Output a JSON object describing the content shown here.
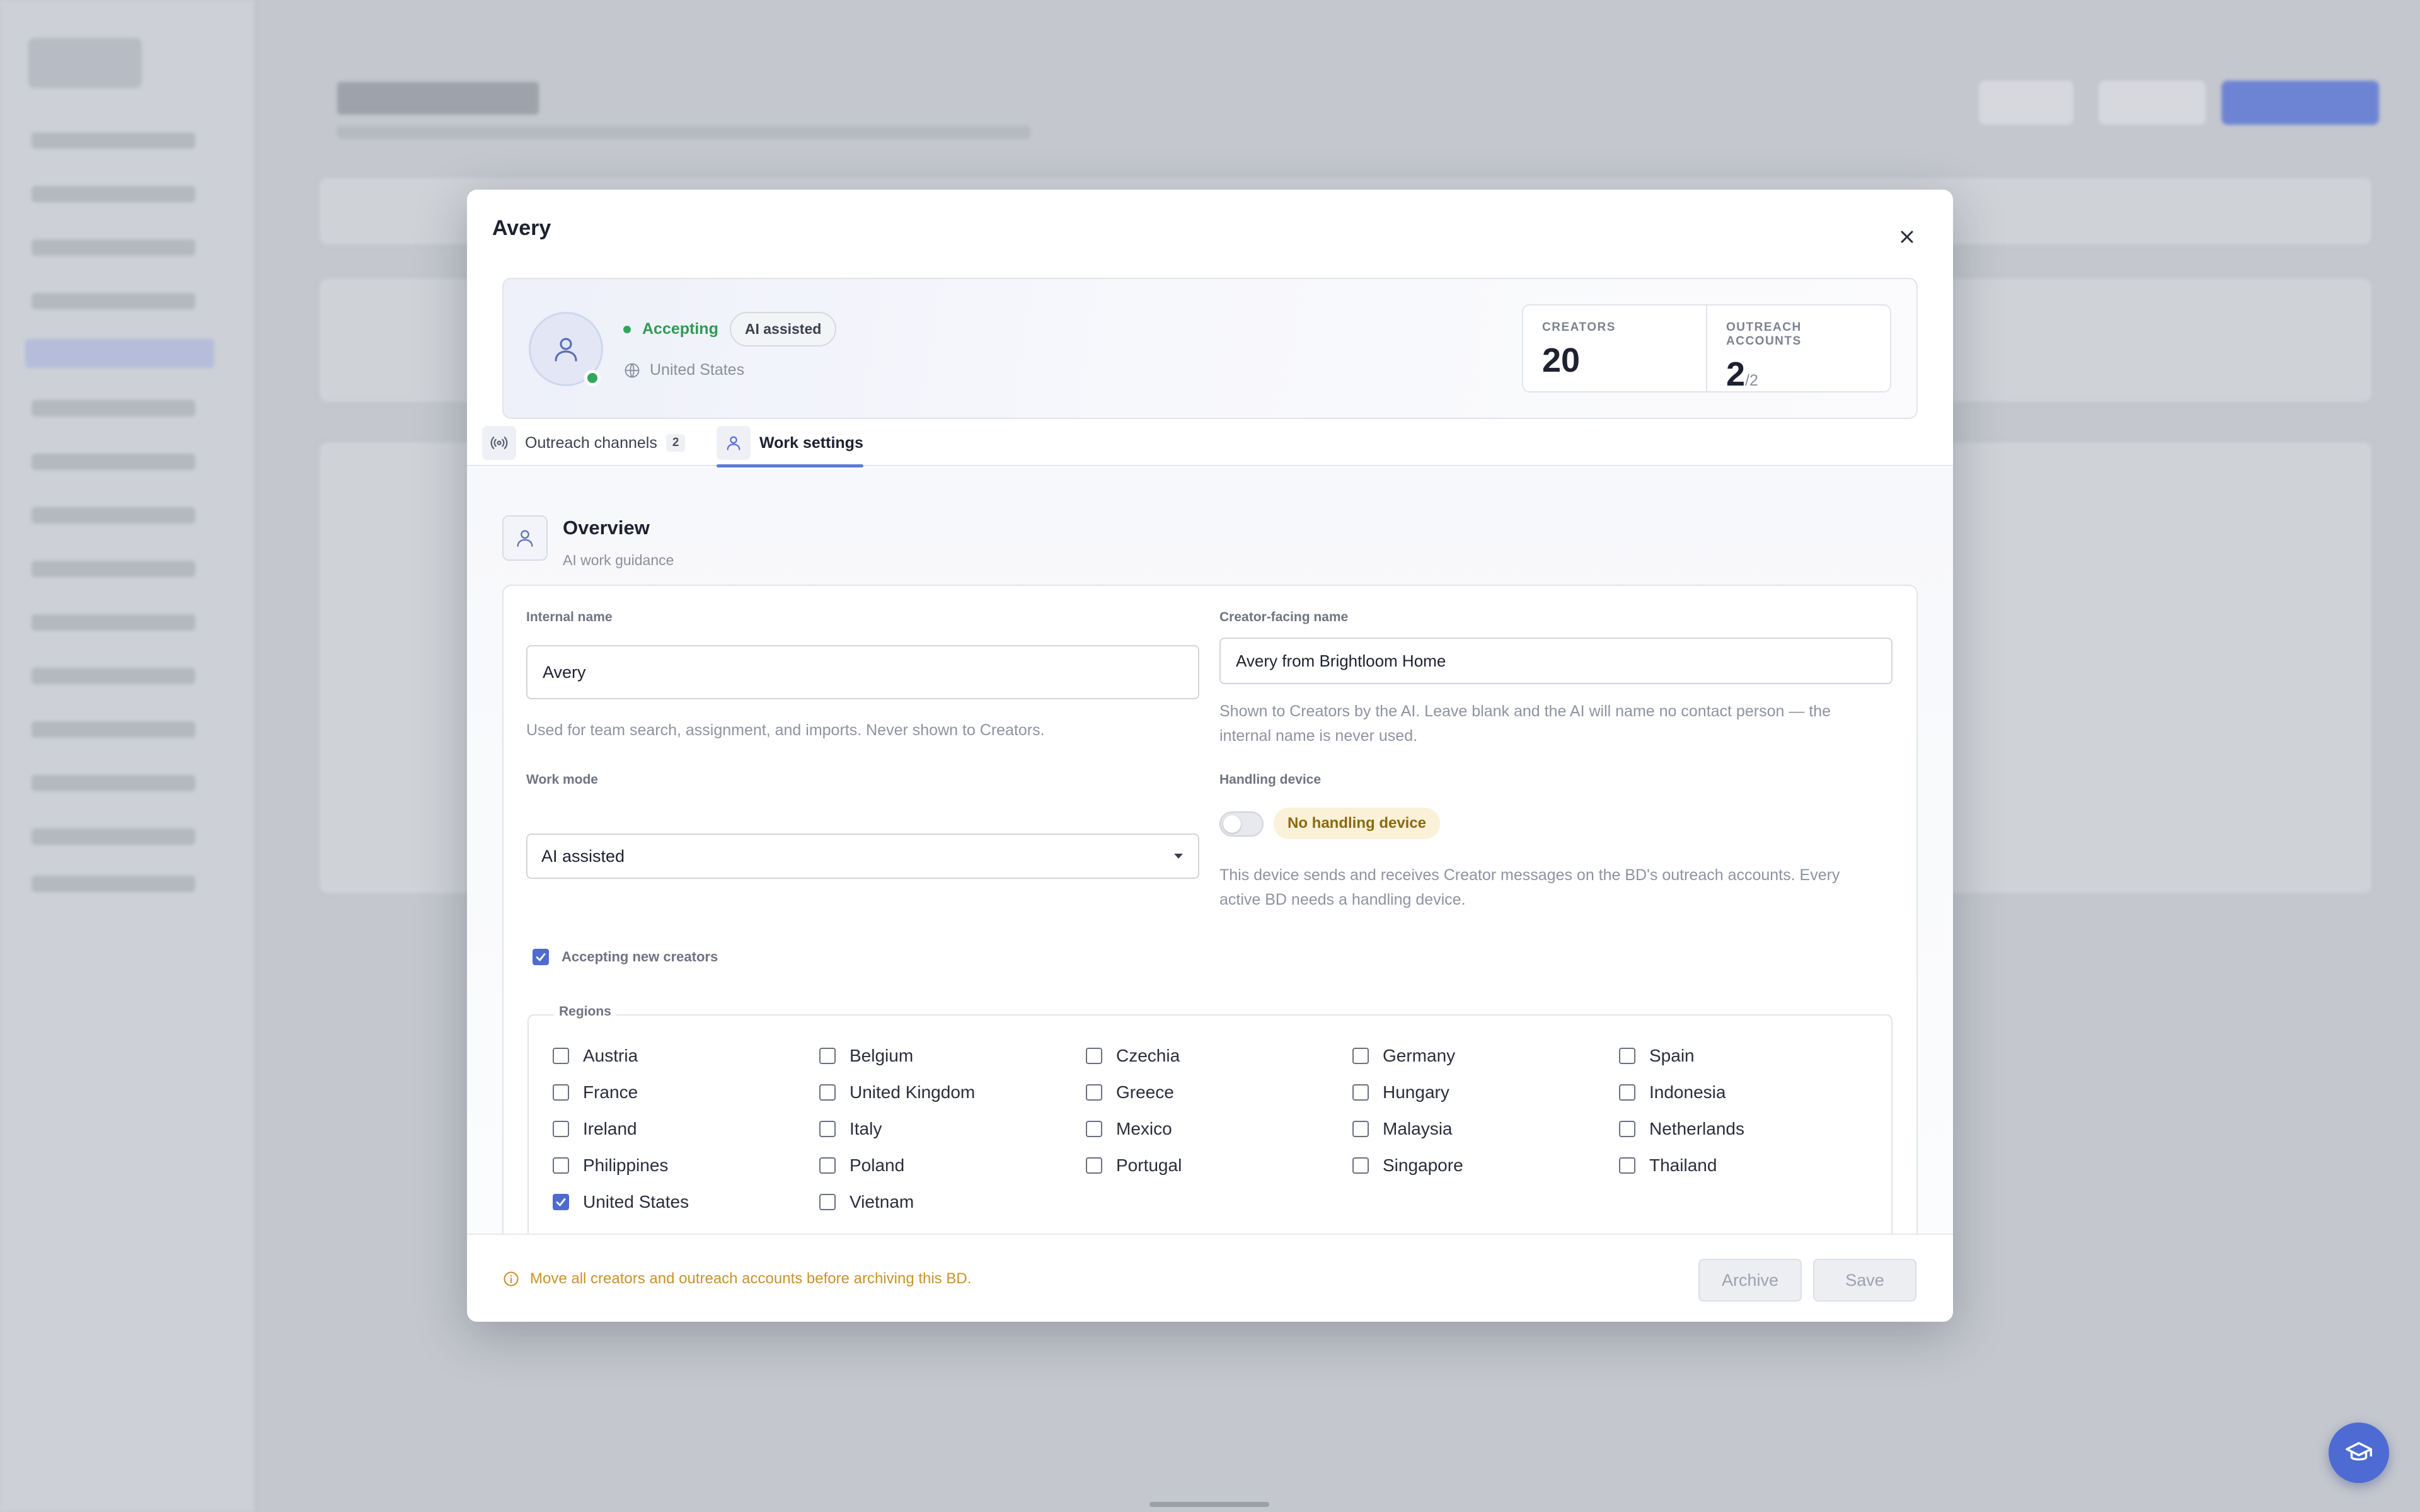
{
  "modal": {
    "title": "Avery",
    "profile": {
      "status": "Accepting",
      "mode_badge": "AI assisted",
      "country": "United States",
      "stats": {
        "creators_label": "CREATORS",
        "creators_value": "20",
        "accounts_label": "OUTREACH ACCOUNTS",
        "accounts_value": "2",
        "accounts_denom": "/2"
      }
    },
    "tabs": [
      {
        "label": "Outreach channels",
        "count": "2",
        "icon": "broadcast-icon"
      },
      {
        "label": "Work settings",
        "icon": "user-icon",
        "active": true
      }
    ],
    "overview": {
      "title": "Overview",
      "subtitle": "AI work guidance"
    },
    "form": {
      "internal_name_label": "Internal name",
      "internal_name_value": "Avery",
      "internal_name_help": "Used for team search, assignment, and imports. Never shown to Creators.",
      "creator_name_label": "Creator-facing name",
      "creator_name_value": "Avery from Brightloom Home",
      "creator_name_help_1": "Shown to Creators by the AI. Leave blank and the AI will name no contact person — the",
      "creator_name_help_2": "internal name is never used.",
      "work_mode_label": "Work mode",
      "work_mode_value": "AI assisted",
      "handling_label": "Handling device",
      "handling_badge": "No handling device",
      "handling_help_1": "This device sends and receives Creator messages on the BD's outreach accounts. Every",
      "handling_help_2": "active BD needs a handling device.",
      "accepting_label": "Accepting new creators",
      "regions_label": "Regions",
      "regions": [
        {
          "name": "Austria",
          "checked": false
        },
        {
          "name": "Belgium",
          "checked": false
        },
        {
          "name": "Czechia",
          "checked": false
        },
        {
          "name": "Germany",
          "checked": false
        },
        {
          "name": "Spain",
          "checked": false
        },
        {
          "name": "France",
          "checked": false
        },
        {
          "name": "United Kingdom",
          "checked": false
        },
        {
          "name": "Greece",
          "checked": false
        },
        {
          "name": "Hungary",
          "checked": false
        },
        {
          "name": "Indonesia",
          "checked": false
        },
        {
          "name": "Ireland",
          "checked": false
        },
        {
          "name": "Italy",
          "checked": false
        },
        {
          "name": "Mexico",
          "checked": false
        },
        {
          "name": "Malaysia",
          "checked": false
        },
        {
          "name": "Netherlands",
          "checked": false
        },
        {
          "name": "Philippines",
          "checked": false
        },
        {
          "name": "Poland",
          "checked": false
        },
        {
          "name": "Portugal",
          "checked": false
        },
        {
          "name": "Singapore",
          "checked": false
        },
        {
          "name": "Thailand",
          "checked": false
        },
        {
          "name": "United States",
          "checked": true
        },
        {
          "name": "Vietnam",
          "checked": false
        }
      ]
    },
    "footer": {
      "warning": "Move all creators and outreach accounts before archiving this BD.",
      "archive_label": "Archive",
      "save_label": "Save"
    }
  },
  "colors": {
    "accent": "#4f6bd0",
    "success": "#2fa85a",
    "warning": "#c9922a"
  }
}
